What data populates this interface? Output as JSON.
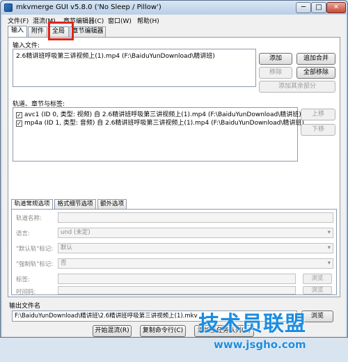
{
  "window": {
    "title": "mkvmerge GUI v5.8.0 ('No Sleep / Pillow')",
    "min_symbol": "─",
    "max_symbol": "□",
    "close_symbol": "✕"
  },
  "menu": [
    "文件(F)",
    "混流(M)",
    "章节编辑器(C)",
    "窗口(W)",
    "帮助(H)"
  ],
  "main_tabs": [
    "输入",
    "附件",
    "全局",
    "章节编辑器"
  ],
  "input": {
    "files_label": "输入文件:",
    "file": "2.6精讲班呼吸第三讲视频上(1).mp4 (F:\\BaiduYunDownload\\精讲班)",
    "add": "添加",
    "append": "追加合并",
    "remove": "移除",
    "remove_all": "全部移除",
    "add_other": "添加其余部分"
  },
  "tracks": {
    "label": "轨道、章节与标签:",
    "items": [
      "avc1 (ID 0, 类型: 视频) 自 2.6精讲班呼吸第三讲视频上(1).mp4 (F:\\BaiduYunDownload\\精讲班)",
      "mp4a (ID 1, 类型: 音频) 自 2.6精讲班呼吸第三讲视频上(1).mp4 (F:\\BaiduYunDownload\\精讲班)"
    ],
    "check": "✓",
    "up": "上移",
    "down": "下移"
  },
  "sub_tabs": [
    "轨道常规选项",
    "格式细节选项",
    "额外选项"
  ],
  "options": {
    "track_name": "轨道名称:",
    "language": "语言:",
    "language_value": "und (未定)",
    "default_flag": "\"默认轨\"标记:",
    "default_value": "默认",
    "forced_flag": "\"强制轨\"标记:",
    "forced_value": "否",
    "tags": "标签:",
    "timecodes": "时间码:",
    "browse": "浏览"
  },
  "output": {
    "label": "输出文件名",
    "path": "F:\\BaiduYunDownload\\精讲班\\2.6精讲班呼吸第三讲视频上(1).mkv",
    "browse": "浏览",
    "start_mux": "开始混流(R)",
    "copy_cmd": "复制命令行(C)",
    "add_queue": "添加至任务队列(A)"
  },
  "watermark": {
    "brand": "技术员联盟",
    "url": "www.jsgho.com"
  },
  "colors": {
    "highlight": "#e0241c",
    "watermark": "#1d8de0"
  }
}
